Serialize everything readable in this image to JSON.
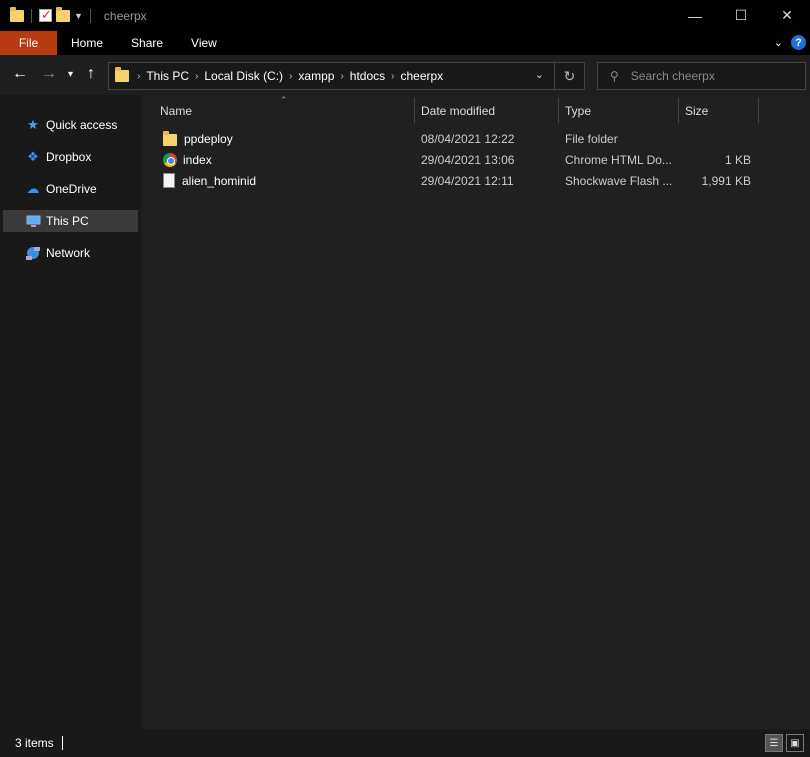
{
  "window": {
    "title": "cheerpx"
  },
  "window_controls": {
    "minimize": "—",
    "maximize": "☐",
    "close": "✕"
  },
  "ribbon": {
    "tabs": [
      {
        "label": "File"
      },
      {
        "label": "Home"
      },
      {
        "label": "Share"
      },
      {
        "label": "View"
      }
    ],
    "help": "?"
  },
  "nav": {
    "breadcrumbs": [
      "This PC",
      "Local Disk (C:)",
      "xampp",
      "htdocs",
      "cheerpx"
    ]
  },
  "search": {
    "placeholder": "Search cheerpx",
    "value": ""
  },
  "sidebar": {
    "items": [
      {
        "label": "Quick access",
        "icon": "star-icon"
      },
      {
        "label": "Dropbox",
        "icon": "dropbox-icon"
      },
      {
        "label": "OneDrive",
        "icon": "cloud-icon"
      },
      {
        "label": "This PC",
        "icon": "monitor-icon",
        "selected": true
      },
      {
        "label": "Network",
        "icon": "network-icon"
      }
    ]
  },
  "columns": {
    "name": "Name",
    "date": "Date modified",
    "type": "Type",
    "size": "Size"
  },
  "files": [
    {
      "name": "ppdeploy",
      "date": "08/04/2021 12:22",
      "type": "File folder",
      "size": "",
      "icon": "folder-icon"
    },
    {
      "name": "index",
      "date": "29/04/2021 13:06",
      "type": "Chrome HTML Do...",
      "size": "1 KB",
      "icon": "chrome-icon"
    },
    {
      "name": "alien_hominid",
      "date": "29/04/2021 12:11",
      "type": "Shockwave Flash ...",
      "size": "1,991 KB",
      "icon": "file-icon"
    }
  ],
  "status": {
    "items_count": "3 items"
  },
  "colors": {
    "file_tab": "#b73a10",
    "background": "#202020",
    "sidebar": "#191919",
    "selected": "#3a3a3a"
  }
}
